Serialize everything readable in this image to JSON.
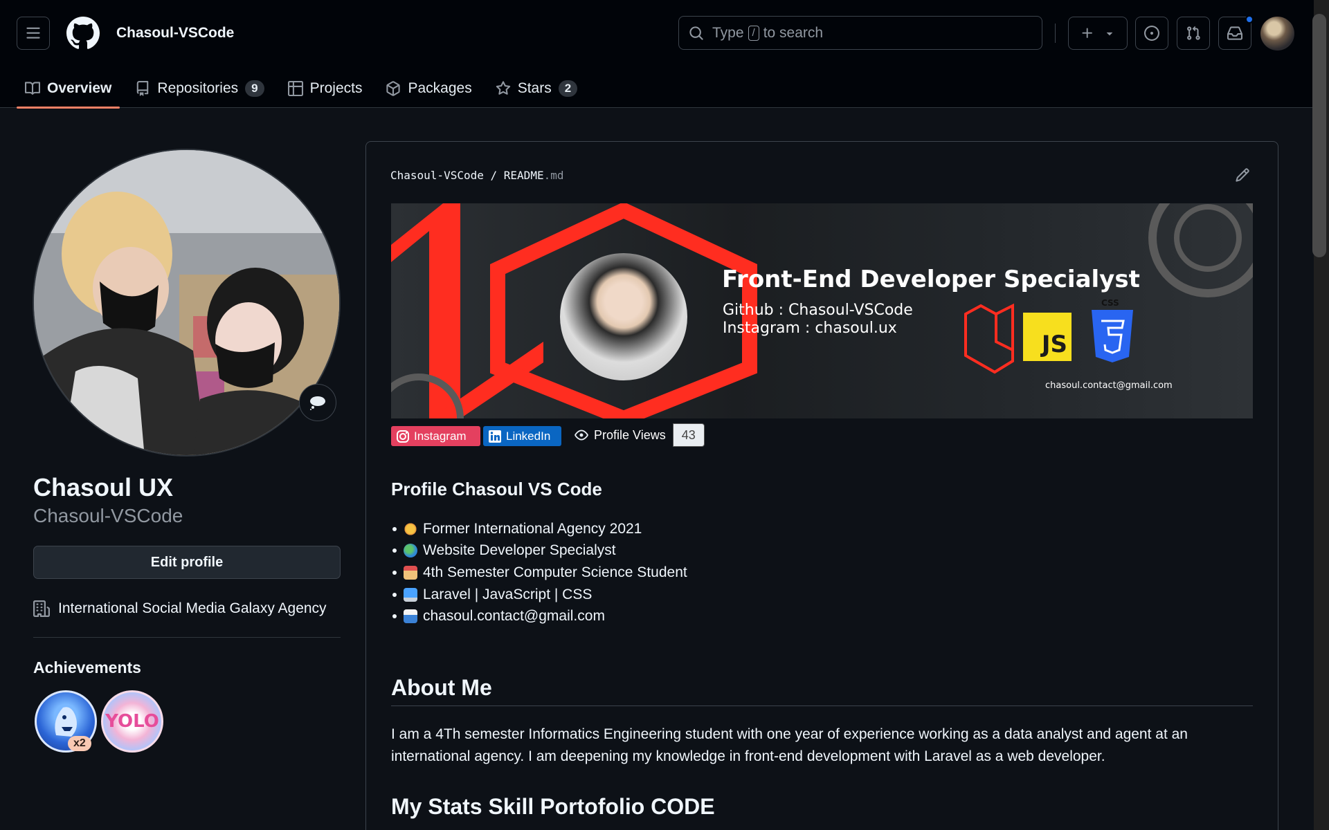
{
  "header": {
    "owner": "Chasoul-VSCode",
    "search": {
      "prefix": "Type",
      "key": "/",
      "suffix": "to search"
    }
  },
  "tabs": [
    {
      "label": "Overview",
      "active": true
    },
    {
      "label": "Repositories",
      "count": "9"
    },
    {
      "label": "Projects"
    },
    {
      "label": "Packages"
    },
    {
      "label": "Stars",
      "count": "2"
    }
  ],
  "profile": {
    "display_name": "Chasoul UX",
    "username": "Chasoul-VSCode",
    "edit_label": "Edit profile",
    "organization": "International Social Media Galaxy Agency",
    "achievements_title": "Achievements",
    "achievements": [
      {
        "name": "shark",
        "count": "x2"
      },
      {
        "name": "yolo",
        "text": "YOLO"
      }
    ]
  },
  "readme": {
    "path_owner": "Chasoul-VSCode",
    "path_sep": "/",
    "path_file": "README",
    "path_ext": ".md",
    "banner": {
      "title": "Front-End Developer Specialyst",
      "github": "Github :  Chasoul-VSCode",
      "instagram": "Instagram : chasoul.ux",
      "email": "chasoul.contact@gmail.com",
      "js_label": "JS",
      "css_label": "CSS"
    },
    "shields": {
      "instagram": "Instagram",
      "linkedin": "LinkedIn"
    },
    "views": {
      "label": "Profile Views",
      "count": "43"
    },
    "profile_heading": "Profile Chasoul VS Code",
    "bullets": [
      {
        "icon": "medal-icon",
        "text": "Former International Agency 2021"
      },
      {
        "icon": "globe-icon",
        "text": " Website Developer Specialyst"
      },
      {
        "icon": "school-icon",
        "text": "4th Semester Computer Science Student"
      },
      {
        "icon": "computer-icon",
        "text": " Laravel | JavaScript | CSS"
      },
      {
        "icon": "mailbox-icon",
        "text": " chasoul.contact@gmail.com"
      }
    ],
    "about_heading": "About Me",
    "about_text": "I am a 4Th semester Informatics Engineering student with one year of experience working as a data analyst and agent at an international agency. I am deepening my knowledge in front-end development with Laravel as a web developer.",
    "stats_heading": "My Stats Skill Portofolio CODE"
  },
  "colors": {
    "bg": "#0d1117",
    "header_bg": "#010409",
    "accent_tab": "#f78166",
    "banner_red": "#ff2d20",
    "instagram": "#e4405f",
    "linkedin": "#0a66c2",
    "notification": "#1f6feb"
  }
}
